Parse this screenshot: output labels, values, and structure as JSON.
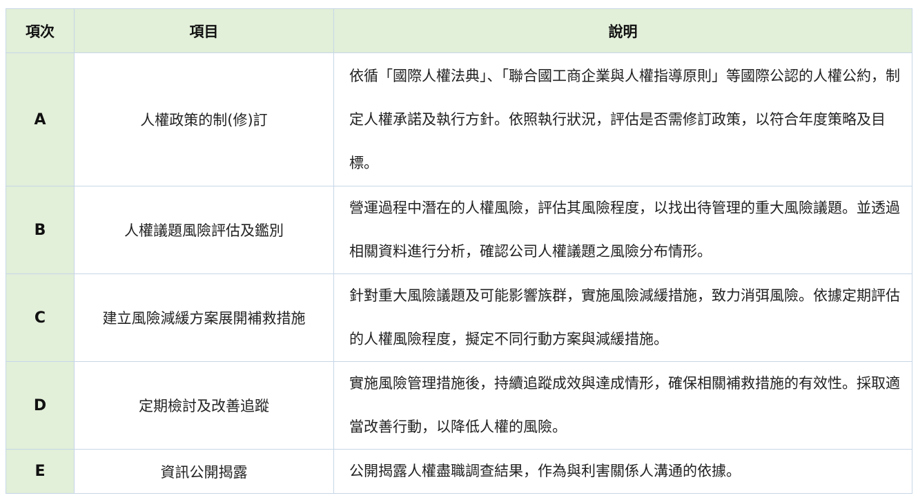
{
  "table": {
    "headers": {
      "code": "項次",
      "item": "項目",
      "desc": "說明"
    },
    "rows": [
      {
        "code": "A",
        "item": "人權政策的制(修)訂",
        "desc": "依循「國際人權法典」、「聯合國工商企業與人權指導原則」等國際公認的人權公約，制定人權承諾及執行方針。依照執行狀況，評估是否需修訂政策，以符合年度策略及目標。"
      },
      {
        "code": "B",
        "item": "人權議題風險評估及鑑別",
        "desc": "營運過程中潛在的人權風險，評估其風險程度，以找出待管理的重大風險議題。並透過相關資料進行分析，確認公司人權議題之風險分布情形。"
      },
      {
        "code": "C",
        "item": "建立風險減緩方案展開補救措施",
        "desc": "針對重大風險議題及可能影響族群，實施風險減緩措施，致力消弭風險。依據定期評估的人權風險程度，擬定不同行動方案與減緩措施。"
      },
      {
        "code": "D",
        "item": "定期檢討及改善追蹤",
        "desc": "實施風險管理措施後，持續追蹤成效與達成情形，確保相關補救措施的有效性。採取適當改善行動，以降低人權的風險。"
      },
      {
        "code": "E",
        "item": "資訊公開揭露",
        "desc": "公開揭露人權盡職調查結果，作為與利害關係人溝通的依據。"
      }
    ]
  },
  "colors": {
    "header_bg": "#e2efd9",
    "border": "#c6d6e6"
  }
}
